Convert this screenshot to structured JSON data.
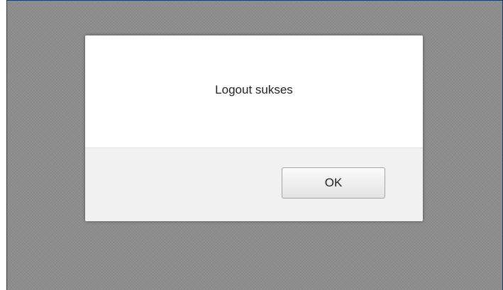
{
  "dialog": {
    "message": "Logout sukses",
    "ok_label": "OK"
  },
  "colors": {
    "overlay": "#8d8d8d",
    "dialog_body": "#ffffff",
    "dialog_footer": "#f1f1f1",
    "window_border": "#1f3a66"
  }
}
